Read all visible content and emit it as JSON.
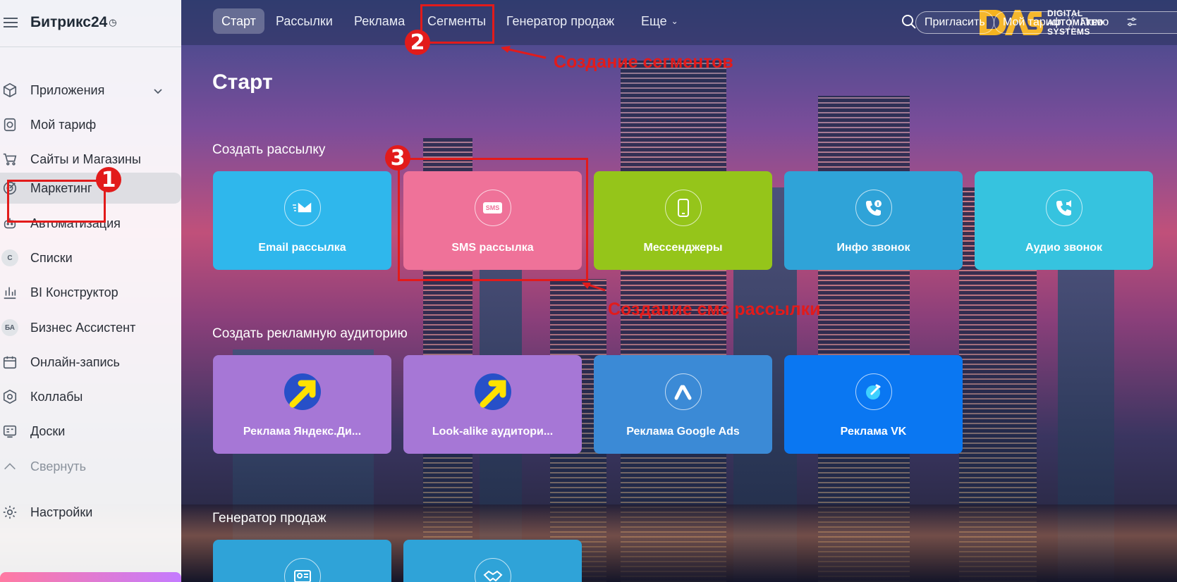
{
  "sidebar": {
    "brand": "Битрикс24",
    "brand_clock": "◷",
    "items": [
      {
        "label": "Приложения"
      },
      {
        "label": "Мой тариф"
      },
      {
        "label": "Сайты и Магазины"
      },
      {
        "label": "Маркетинг"
      },
      {
        "label": "Автоматизация"
      },
      {
        "label": "Списки",
        "badge": "С"
      },
      {
        "label": "BI Конструктор"
      },
      {
        "label": "Бизнес Ассистент",
        "badge": "БА"
      },
      {
        "label": "Онлайн-запись"
      },
      {
        "label": "Коллабы"
      },
      {
        "label": "Доски"
      },
      {
        "label": "Свернуть"
      },
      {
        "label": "Настройки"
      }
    ]
  },
  "topbar": {
    "tabs": [
      {
        "label": "Старт"
      },
      {
        "label": "Рассылки"
      },
      {
        "label": "Реклама"
      },
      {
        "label": "Сегменты"
      },
      {
        "label": "Генератор продаж"
      },
      {
        "label": "Еще"
      }
    ],
    "logo_lines": [
      "DIGITAL",
      "AUTOMATED",
      "SYSTEMS"
    ],
    "buttons": [
      {
        "label": "Пригласить"
      },
      {
        "label": "Мой тариф"
      },
      {
        "label": "Помо"
      }
    ]
  },
  "main": {
    "title": "Старт",
    "sections": [
      {
        "title": "Создать рассылку",
        "tiles": [
          {
            "label": "Email рассылка",
            "color": "#2fb7ec"
          },
          {
            "label": "SMS рассылка",
            "color": "#ef7299",
            "icon_text": "SMS"
          },
          {
            "label": "Мессенджеры",
            "color": "#95c51a"
          },
          {
            "label": "Инфо звонок",
            "color": "#2fa3d8"
          },
          {
            "label": "Аудио звонок",
            "color": "#36c3df"
          }
        ]
      },
      {
        "title": "Создать рекламную аудиторию",
        "tiles": [
          {
            "label": "Реклама Яндекс.Ди...",
            "color": "#a677d6"
          },
          {
            "label": "Look-alike аудитори...",
            "color": "#a677d6"
          },
          {
            "label": "Реклама Google Ads",
            "color": "#3b8ad6"
          },
          {
            "label": "Реклама VK",
            "color": "#0a77f2"
          }
        ]
      },
      {
        "title": "Генератор продаж",
        "tiles": [
          {
            "label": "",
            "color": "#2fa3d8"
          },
          {
            "label": "",
            "color": "#2fa3d8"
          }
        ]
      }
    ]
  },
  "annotations": {
    "badges": [
      "1",
      "2",
      "3"
    ],
    "notes": [
      "Создание сегментов",
      "Создание смс рассылки"
    ],
    "color": "#e21b1b"
  }
}
